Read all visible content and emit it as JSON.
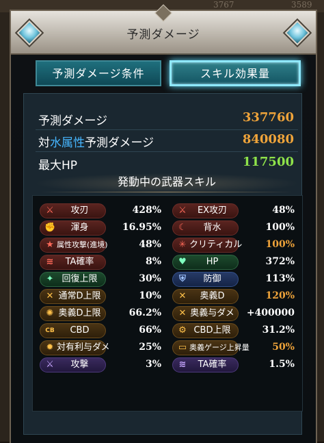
{
  "background": {
    "numbers": [
      "3767",
      "3589"
    ]
  },
  "dialog": {
    "title": "予測ダメージ"
  },
  "tabs": [
    {
      "label": "予測ダメージ条件",
      "active": false
    },
    {
      "label": "スキル効果量",
      "active": true
    }
  ],
  "stats": {
    "predicted": {
      "label": "予測ダメージ",
      "value": "337760",
      "color": "#f0a43a"
    },
    "element": {
      "prefix": "対",
      "element": "水属性",
      "suffix": "予測ダメージ",
      "value": "840080",
      "color": "#f0a43a"
    },
    "hp": {
      "label": "最大HP",
      "value": "117500",
      "color": "#8fe34a"
    }
  },
  "section": {
    "title": "発動中の武器スキル"
  },
  "skills_left": [
    {
      "label": "攻刃",
      "value": "428%",
      "icon": "sword-icon",
      "style": "red",
      "value_color": "#ffffff"
    },
    {
      "label": "渾身",
      "value": "16.95%",
      "icon": "muscle-icon",
      "style": "red",
      "value_color": "#ffffff"
    },
    {
      "label": "属性攻撃(進境)",
      "value": "48%",
      "icon": "star-icon",
      "style": "red",
      "value_color": "#ffffff"
    },
    {
      "label": "TA確率",
      "value": "8%",
      "icon": "triple-slash-icon",
      "style": "red",
      "value_color": "#ffffff"
    },
    {
      "label": "回復上限",
      "value": "30%",
      "icon": "sparkle-icon",
      "style": "green",
      "value_color": "#ffffff"
    },
    {
      "label": "通常D上限",
      "value": "10%",
      "icon": "crossed-swords-icon",
      "style": "gold",
      "value_color": "#ffffff"
    },
    {
      "label": "奥義D上限",
      "value": "66.2%",
      "icon": "ougi-icon",
      "style": "gold",
      "value_color": "#ffffff"
    },
    {
      "label": "CBD",
      "value": "66%",
      "icon": "cb-icon",
      "style": "gold",
      "value_color": "#ffffff"
    },
    {
      "label": "対有利与ダメ",
      "value": "25%",
      "icon": "gear-icon",
      "style": "gold",
      "value_color": "#ffffff"
    },
    {
      "label": "攻撃",
      "value": "3%",
      "icon": "purple-sword-icon",
      "style": "purple",
      "value_color": "#ffffff"
    }
  ],
  "skills_right": [
    {
      "label": "EX攻刃",
      "value": "48%",
      "icon": "sword-icon",
      "style": "red",
      "value_color": "#ffffff"
    },
    {
      "label": "背水",
      "value": "100%",
      "icon": "crescent-icon",
      "style": "red",
      "value_color": "#ffffff"
    },
    {
      "label": "クリティカル",
      "value": "100%",
      "icon": "burst-icon",
      "style": "red",
      "value_color": "#f0a43a"
    },
    {
      "label": "HP",
      "value": "372%",
      "icon": "heart-icon",
      "style": "green",
      "value_color": "#ffffff"
    },
    {
      "label": "防御",
      "value": "113%",
      "icon": "shield-icon",
      "style": "blue",
      "value_color": "#ffffff"
    },
    {
      "label": "奥義D",
      "value": "120%",
      "icon": "crossed-swords-icon",
      "style": "gold",
      "value_color": "#f0a43a"
    },
    {
      "label": "奥義与ダメ",
      "value": "+400000",
      "icon": "crossed-swords-icon",
      "style": "gold",
      "value_color": "#ffffff"
    },
    {
      "label": "CBD上限",
      "value": "31.2%",
      "icon": "cb-limit-icon",
      "style": "gold",
      "value_color": "#ffffff"
    },
    {
      "label": "奥義ゲージ上昇量",
      "value": "50%",
      "icon": "gauge-icon",
      "style": "gold",
      "value_color": "#f0a43a"
    },
    {
      "label": "TA確率",
      "value": "1.5%",
      "icon": "purple-triple-slash-icon",
      "style": "purple",
      "value_color": "#ffffff"
    }
  ]
}
